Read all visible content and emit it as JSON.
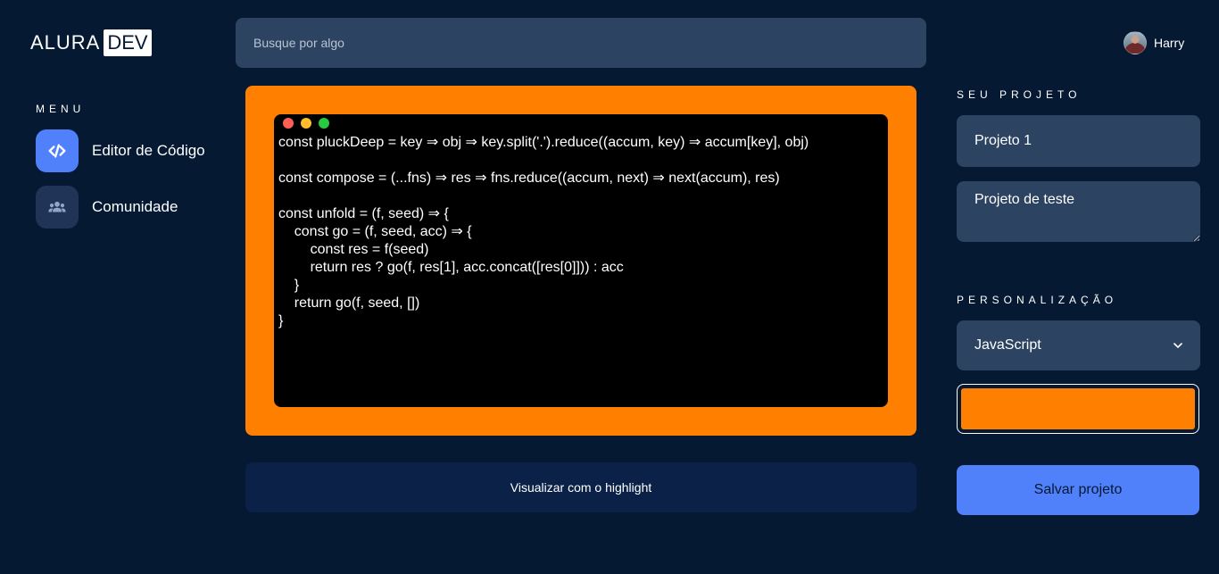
{
  "logo": {
    "alura": "ALURA",
    "dev": "DEV"
  },
  "search": {
    "placeholder": "Busque por algo"
  },
  "user": {
    "name": "Harry"
  },
  "menu": {
    "title": "MENU",
    "items": [
      {
        "label": "Editor de Código",
        "icon": "code-icon",
        "active": true
      },
      {
        "label": "Comunidade",
        "icon": "users-icon",
        "active": false
      }
    ]
  },
  "editor": {
    "background": "#ff8000",
    "code": "const pluckDeep = key ⇒ obj ⇒ key.split('.').reduce((accum, key) ⇒ accum[key], obj)\n\nconst compose = (...fns) ⇒ res ⇒ fns.reduce((accum, next) ⇒ next(accum), res)\n\nconst unfold = (f, seed) ⇒ {\n    const go = (f, seed, acc) ⇒ {\n        const res = f(seed)\n        return res ? go(f, res[1], acc.concat([res[0]])) : acc\n    }\n    return go(f, seed, [])\n}"
  },
  "highlight_button": {
    "label": "Visualizar com o highlight"
  },
  "project": {
    "section_title": "SEU PROJETO",
    "name": "Projeto 1",
    "description": "Projeto de teste"
  },
  "customization": {
    "section_title": "PERSONALIZAÇÃO",
    "language": "JavaScript",
    "color": "#ff8000"
  },
  "save_button": {
    "label": "Salvar projeto"
  },
  "colors": {
    "page_bg": "#051933",
    "accent": "#5081fb",
    "field_bg": "#2d4362"
  }
}
